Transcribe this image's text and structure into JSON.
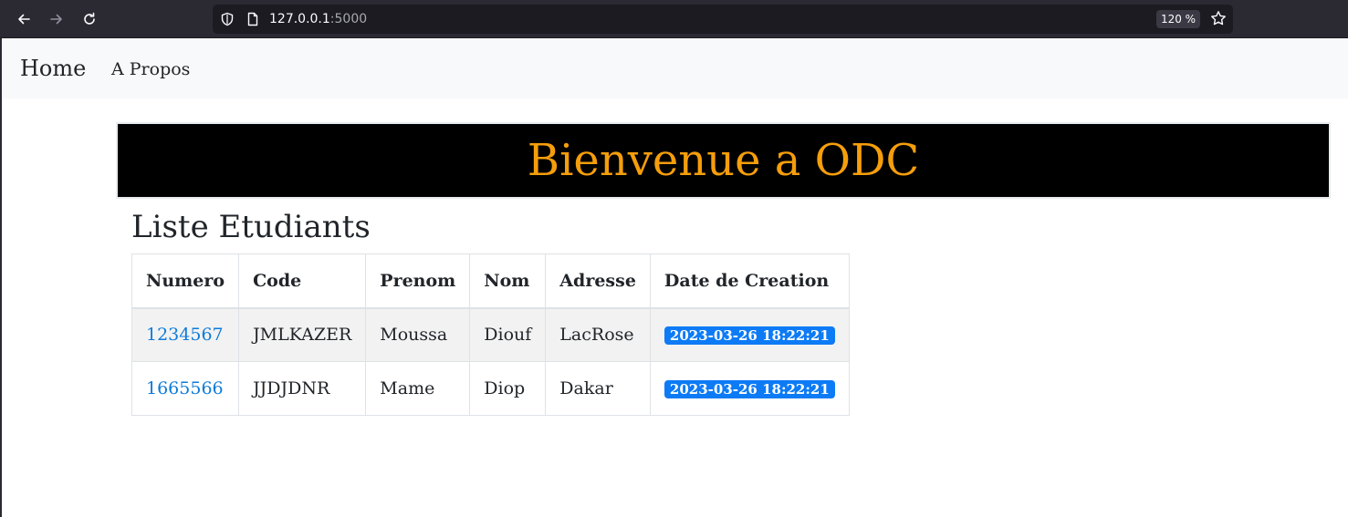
{
  "browser": {
    "url_host": "127.0.0.1",
    "url_port": ":5000",
    "zoom": "120 %"
  },
  "navbar": {
    "brand": "Home",
    "links": [
      "A Propos"
    ]
  },
  "hero": {
    "title": "Bienvenue a ODC"
  },
  "list": {
    "title": "Liste Etudiants",
    "columns": [
      "Numero",
      "Code",
      "Prenom",
      "Nom",
      "Adresse",
      "Date de Creation"
    ],
    "rows": [
      {
        "numero": "1234567",
        "code": "JMLKAZER",
        "prenom": "Moussa",
        "nom": "Diouf",
        "adresse": "LacRose",
        "date": "2023-03-26 18:22:21"
      },
      {
        "numero": "1665566",
        "code": "JJDJDNR",
        "prenom": "Mame",
        "nom": "Diop",
        "adresse": "Dakar",
        "date": "2023-03-26 18:22:21"
      }
    ]
  },
  "colors": {
    "hero_background": "#000000",
    "hero_text": "#f59e0b",
    "link": "#0d7bd9",
    "badge": "#0d7bf5",
    "navbar_background": "#f8f9fa"
  }
}
